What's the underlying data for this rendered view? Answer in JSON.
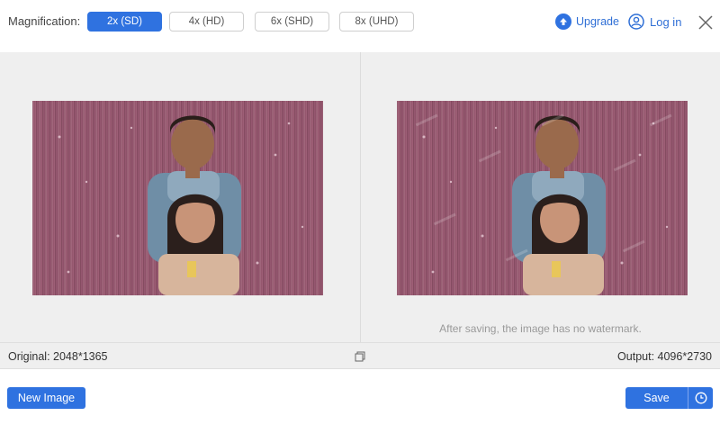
{
  "toolbar": {
    "magnification_label": "Magnification:",
    "options": [
      "2x (SD)",
      "4x (HD)",
      "6x (SHD)",
      "8x (UHD)"
    ],
    "selected": "2x (SD)",
    "upgrade_label": "Upgrade",
    "login_label": "Log in"
  },
  "preview": {
    "watermark_note": "After saving, the image has no watermark."
  },
  "info": {
    "original": "Original: 2048*1365",
    "output": "Output: 4096*2730"
  },
  "actions": {
    "new_image_label": "New Image",
    "save_label": "Save"
  },
  "colors": {
    "accent": "#2f72e0",
    "background_panel": "#efefef"
  },
  "icons": {
    "upgrade": "upgrade-arrow-icon",
    "login": "user-icon",
    "close": "close-icon",
    "compare": "compare-icon",
    "history": "clock-icon"
  }
}
